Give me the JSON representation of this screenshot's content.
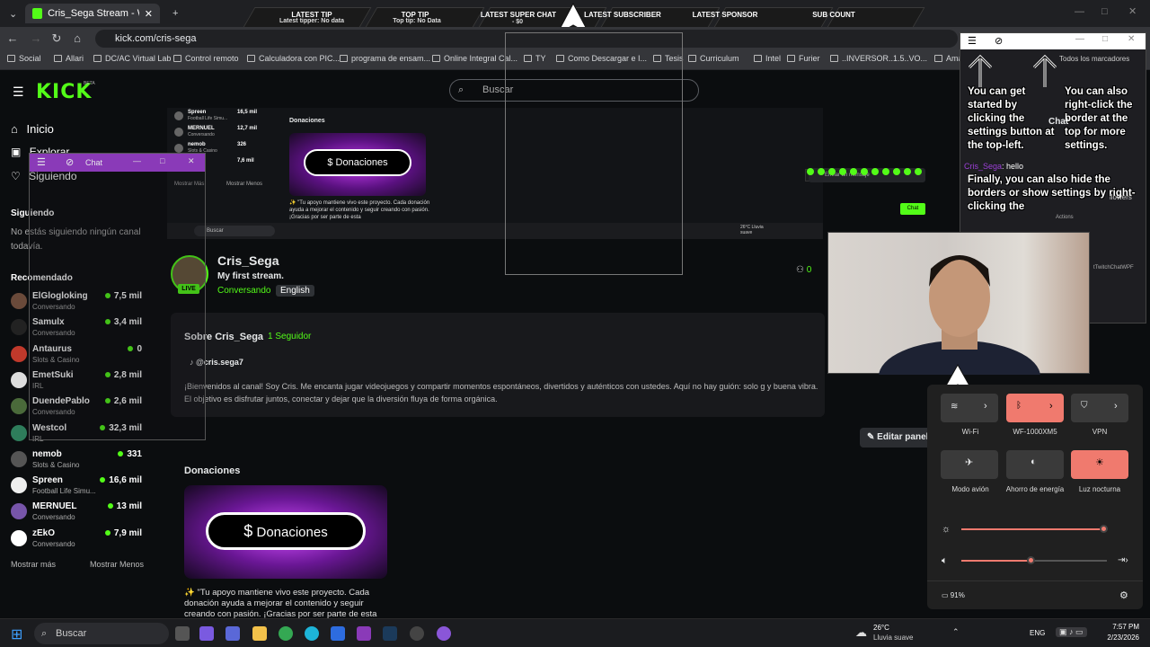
{
  "browser": {
    "tab_title": "Cris_Sega Stream - Watch Live o",
    "url": "kick.com/cris-sega",
    "bookmarks": [
      "Social",
      "Allari",
      "DC/AC Virtual Lab",
      "Control remoto",
      "Calculadora con PIC...",
      "programa de ensam...",
      "Online Integral Cal...",
      "TY",
      "Como Descargar e I...",
      "Tesis",
      "Curriculum",
      "Intel",
      "Furier",
      "..INVERSOR..1.5..VO...",
      "Amazo"
    ]
  },
  "overlay": {
    "latest_tip_title": "LATEST TIP",
    "latest_tip_sub": "Latest tipper: No data",
    "top_tip_title": "TOP TIP",
    "top_tip_sub": "Top tip: No Data",
    "super_chat_title": "LATEST SUPER CHAT",
    "super_chat_sub": "- $0",
    "subscriber_title": "LATEST SUBSCRIBER",
    "sponsor_title": "LATEST SPONSOR",
    "subcount_title": "SUB COUNT"
  },
  "kick": {
    "logo": "KICK",
    "beta": "BETA",
    "search_placeholder": "Buscar",
    "nav": {
      "home": "Inicio",
      "explore": "Explorar",
      "following": "Siguiendo"
    },
    "following_title": "Siguiendo",
    "following_empty": "No estás siguiendo ningún canal todavía.",
    "recommended_title": "Recomendado",
    "recommended": [
      {
        "name": "ElGlogloking",
        "cat": "Conversando",
        "viewers": "7,5 mil"
      },
      {
        "name": "Samulx",
        "cat": "Conversando",
        "viewers": "3,4 mil"
      },
      {
        "name": "Antaurus",
        "cat": "Slots & Casino",
        "viewers": "0"
      },
      {
        "name": "EmetSuki",
        "cat": "IRL",
        "viewers": "2,8 mil"
      },
      {
        "name": "DuendePablo",
        "cat": "Conversando",
        "viewers": "2,6 mil"
      },
      {
        "name": "Westcol",
        "cat": "IRL",
        "viewers": "32,3 mil"
      },
      {
        "name": "nemob",
        "cat": "Slots & Casino",
        "viewers": "331"
      },
      {
        "name": "Spreen",
        "cat": "Football Life Simu...",
        "viewers": "16,6 mil"
      },
      {
        "name": "MERNUEL",
        "cat": "Conversando",
        "viewers": "13 mil"
      },
      {
        "name": "zEkO",
        "cat": "Conversando",
        "viewers": "7,9 mil"
      }
    ],
    "show_more": "Mostrar más",
    "show_less": "Mostrar Menos",
    "channel": {
      "name": "Cris_Sega",
      "title": "My first stream.",
      "category": "Conversando",
      "language": "English",
      "live": "LIVE",
      "viewers": "0"
    },
    "about": {
      "title": "Sobre Cris_Sega",
      "followers": "1 Seguidor",
      "tiktok": "@cris.sega7",
      "bio": "¡Bienvenidos al canal! Soy Cris. Me encanta jugar videojuegos y compartir momentos espontáneos, divertidos y auténticos con ustedes. Aquí no hay guión: solo g y buena vibra. El objetivo es disfrutar juntos, conectar y dejar que la diversión fluya de forma orgánica."
    },
    "edit_panel": "Editar panel",
    "donations_title": "Donaciones",
    "donations_button": "Donaciones",
    "donations_text": "✨ \"Tu apoyo mantiene vivo este proyecto. Cada donación ayuda a mejorar el contenido y seguir creando con pasión. ¡Gracias por ser parte de esta"
  },
  "preview": {
    "rows": [
      {
        "name": "Spreen",
        "cat": "Football Life Simu...",
        "viewers": "16,5 mil"
      },
      {
        "name": "MERNUEL",
        "cat": "Conversando",
        "viewers": "12,7 mil"
      },
      {
        "name": "nemob",
        "cat": "Slots & Casino",
        "viewers": "326"
      },
      {
        "name": "",
        "cat": "",
        "viewers": "7,6 mil"
      }
    ],
    "show_more": "Mostrar Más",
    "show_less": "Mostrar Menos",
    "donations_title": "Donaciones",
    "donations_button": "Donaciones",
    "donations_text": "✨ \"Tu apoyo mantiene vivo este proyecto. Cada donación ayuda a mejorar el contenido y seguir creando con pasión. ¡Gracias por ser parte de esta",
    "send_placeholder": "Enviar un mensaje",
    "chat_btn": "Chat",
    "search": "Buscar",
    "weather": "26°C Lluvia suave"
  },
  "chat_window": {
    "title": "Chat"
  },
  "chat_overlay": {
    "title": "Chat",
    "tip1": "You can get started by clicking the settings button at the top-left.",
    "tip2": "You can also right-click the border at the top for more settings.",
    "tip3": "Finally, you can also hide the borders or show settings by right-clicking the",
    "msg_user": "Cris_Sega",
    "msg_text": ": hello",
    "bg_text": "llowers",
    "bg_actions": "Actions",
    "bg_app": "tTwitchChatWPF",
    "bookmarks_all": "Todos los marcadores"
  },
  "quick_settings": {
    "wifi": "Wi-Fi",
    "bluetooth": "WF-1000XM5",
    "vpn": "VPN",
    "airplane": "Modo avión",
    "saver": "Ahorro de energía",
    "night": "Luz nocturna",
    "brightness": 0.98,
    "volume": 0.48,
    "battery": "91%"
  },
  "taskbar": {
    "search": "Buscar",
    "weather_temp": "26°C",
    "weather_desc": "Lluvia suave",
    "lang": "ENG",
    "time": "7:57 PM",
    "date": "2/23/2026"
  },
  "colors": {
    "kick_green": "#53fc18",
    "purple": "#9b3fd6",
    "salmon": "#f07a6e"
  }
}
